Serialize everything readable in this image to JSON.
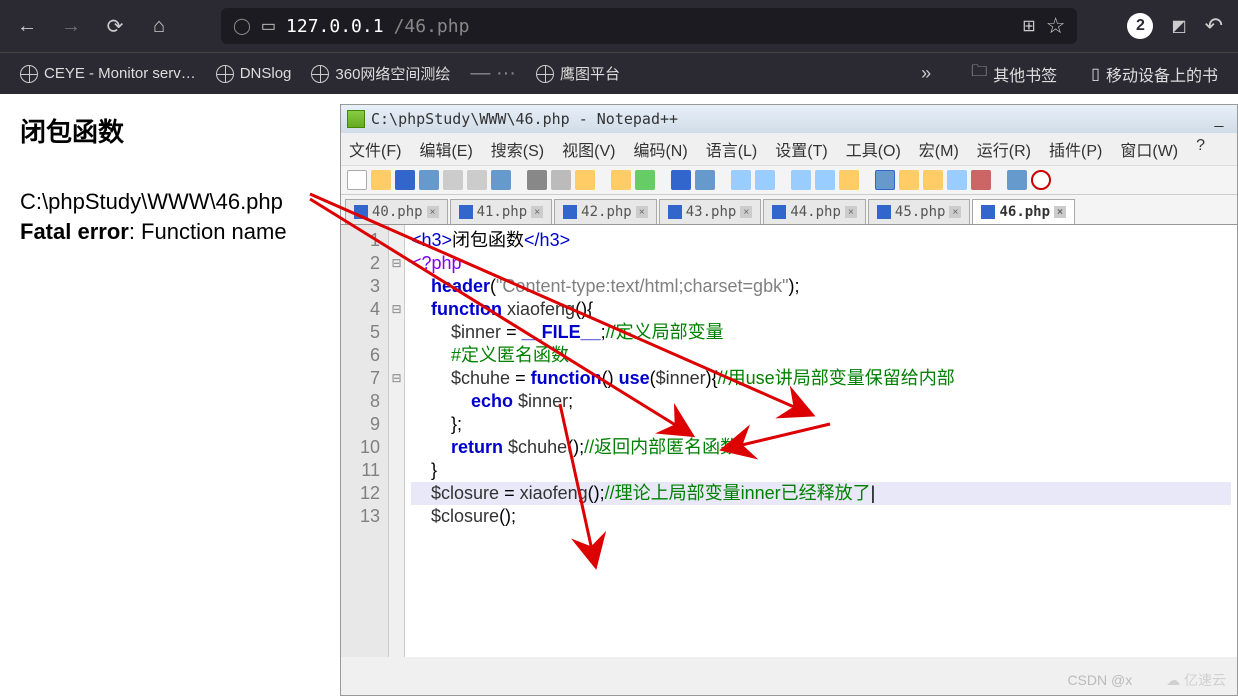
{
  "browser": {
    "url_host": "127.0.0.1",
    "url_path": "/46.php",
    "badge": "2",
    "bookmarks": [
      "CEYE - Monitor serv…",
      "DNSlog",
      "360网络空间测绘",
      "鹰图平台"
    ],
    "folder_bookmark": "其他书签",
    "mobile_bookmark": "移动设备上的书"
  },
  "page": {
    "heading": "闭包函数",
    "path": "C:\\phpStudy\\WWW\\46.php",
    "error_label": "Fatal error",
    "error_text": ": Function name"
  },
  "notepadpp": {
    "title": "C:\\phpStudy\\WWW\\46.php - Notepad++",
    "menu": [
      "文件(F)",
      "编辑(E)",
      "搜索(S)",
      "视图(V)",
      "编码(N)",
      "语言(L)",
      "设置(T)",
      "工具(O)",
      "宏(M)",
      "运行(R)",
      "插件(P)",
      "窗口(W)",
      "?"
    ],
    "tabs": [
      "40.php",
      "41.php",
      "42.php",
      "43.php",
      "44.php",
      "45.php",
      "46.php"
    ],
    "active_tab": 6,
    "code": {
      "lines": [
        {
          "n": 1,
          "html": "<span class='tag'>&lt;h3&gt;</span>闭包函数<span class='tag'>&lt;/h3&gt;</span>"
        },
        {
          "n": 2,
          "html": "<span class='op'>&lt;?php</span>"
        },
        {
          "n": 3,
          "html": "    <span class='kw'>header</span>(<span class='str'>\"Content-type:text/html;charset=gbk\"</span>);"
        },
        {
          "n": 4,
          "html": "    <span class='kw'>function</span> <span class='fn'>xiaofeng</span>(){"
        },
        {
          "n": 5,
          "html": "        <span class='var'>$inner</span> = <span class='kw'>__FILE__</span>;<span class='com'>//定义局部变量</span>"
        },
        {
          "n": 6,
          "html": "        <span class='com'>#定义匿名函数</span>"
        },
        {
          "n": 7,
          "html": "        <span class='var'>$chuhe</span> = <span class='kw'>function</span>() <span class='kw'>use</span>(<span class='var'>$inner</span>){<span class='com'>//用use讲局部变量保留给内部</span>"
        },
        {
          "n": 8,
          "html": "            <span class='kw'>echo</span> <span class='var'>$inner</span>;"
        },
        {
          "n": 9,
          "html": "        };"
        },
        {
          "n": 10,
          "html": "        <span class='kw'>return</span> <span class='var'>$chuhe</span>();<span class='com'>//返回内部匿名函数</span>"
        },
        {
          "n": 11,
          "html": "    }"
        },
        {
          "n": 12,
          "html": "    <span class='var'>$closure</span> = <span class='fn'>xiaofeng</span>();<span class='com'>//理论上局部变量inner已经释放了</span>|",
          "cls": "cl12"
        },
        {
          "n": 13,
          "html": "    <span class='var'>$closure</span>();"
        }
      ]
    }
  },
  "watermark": "CSDN @x",
  "watermark2": "亿速云"
}
